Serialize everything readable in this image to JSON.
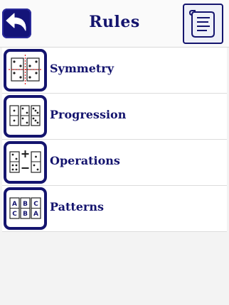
{
  "header": {
    "title": "Rules",
    "back_icon": "back-arrow-icon",
    "scroll_icon": "scroll-icon"
  },
  "rules": [
    {
      "label": "Symmetry",
      "icon": "symmetry-icon"
    },
    {
      "label": "Progression",
      "icon": "progression-icon"
    },
    {
      "label": "Operations",
      "icon": "operations-icon"
    },
    {
      "label": "Patterns",
      "icon": "patterns-icon"
    }
  ],
  "patterns_icon_letters": [
    "A",
    "B",
    "C",
    "C",
    "B",
    "A"
  ],
  "colors": {
    "navy": "#14146e",
    "accent_red": "#d22",
    "background": "#f3f3f3"
  }
}
